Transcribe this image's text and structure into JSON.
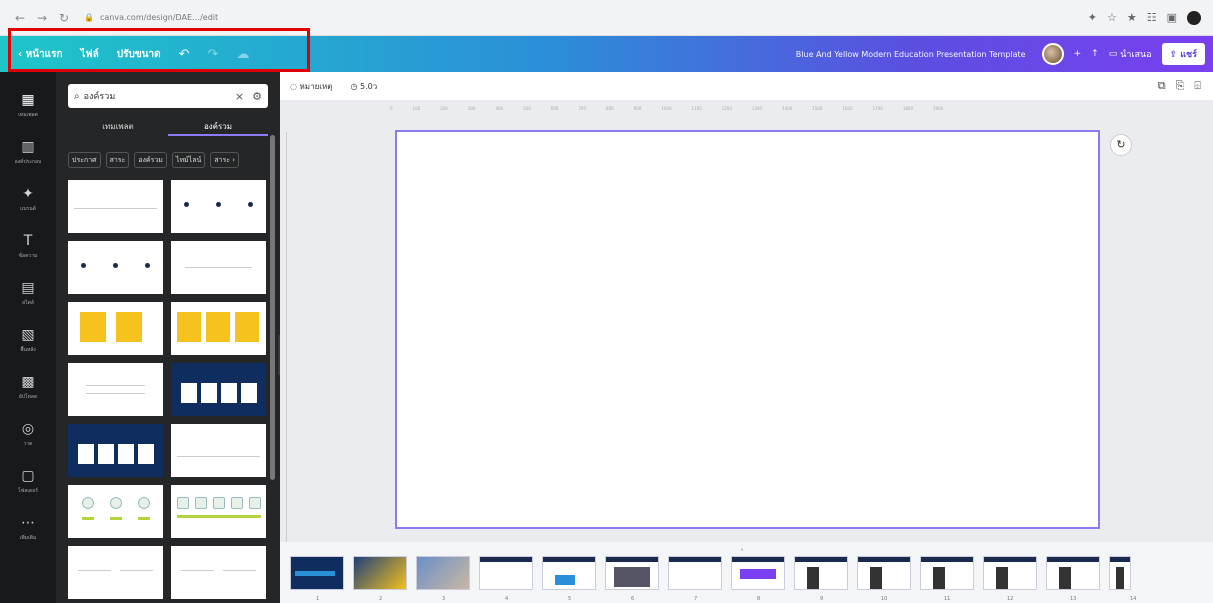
{
  "browser": {
    "url": "canva.com/design/DAE…/edit",
    "nav": {
      "back": "←",
      "forward": "→",
      "reload": "↻"
    },
    "ext_icons": [
      "✦",
      "☆",
      "★",
      "☷",
      "▣"
    ]
  },
  "topbar": {
    "back_label": "‹ หน้าแรก",
    "file_label": "ไฟล์",
    "resize_label": "ปรับขนาด",
    "undo": "↶",
    "redo": "↷",
    "saved": "☁",
    "doc_title": "Blue And Yellow Modern Education Presentation Template",
    "plus": "+",
    "stats": "↑",
    "present_label": "นำเสนอ",
    "share_label": "แชร์"
  },
  "rail": [
    {
      "icon": "▦",
      "label": "เทมเพลต"
    },
    {
      "icon": "▥",
      "label": "องค์ประกอบ"
    },
    {
      "icon": "✦",
      "label": "แบรนด์"
    },
    {
      "icon": "T",
      "label": "ข้อความ"
    },
    {
      "icon": "▤",
      "label": "สไตล์"
    },
    {
      "icon": "▧",
      "label": "พื้นหลัง"
    },
    {
      "icon": "▩",
      "label": "อัปโหลด"
    },
    {
      "icon": "◎",
      "label": "วาด"
    },
    {
      "icon": "▢",
      "label": "โฟลเดอร์"
    },
    {
      "icon": "⋯",
      "label": "เพิ่มเติม"
    }
  ],
  "panel": {
    "search_value": "องค์รวม",
    "clear": "×",
    "filter": "⚙",
    "tabs": [
      {
        "label": "เทมเพลต"
      },
      {
        "label": "องค์รวม"
      }
    ],
    "chips": [
      "ประกาศ",
      "สาระ",
      "องค์รวม",
      "ไทม์ไลน์",
      "สาระ ›"
    ]
  },
  "editor": {
    "notes_label": "หมายเหตุ",
    "timer_label": "5.0ว",
    "right_icons": [
      "⧉",
      "⎘",
      "⌹"
    ],
    "rotate": "↻",
    "handle": "˄"
  },
  "ruler_ticks": [
    "0",
    "100",
    "200",
    "300",
    "400",
    "500",
    "600",
    "700",
    "800",
    "900",
    "1000",
    "1100",
    "1200",
    "1300",
    "1400",
    "1500",
    "1600",
    "1700",
    "1800",
    "1900"
  ],
  "slide_numbers": [
    "1",
    "2",
    "3",
    "4",
    "5",
    "6",
    "7",
    "8",
    "9",
    "10",
    "11",
    "12",
    "13",
    "14"
  ]
}
